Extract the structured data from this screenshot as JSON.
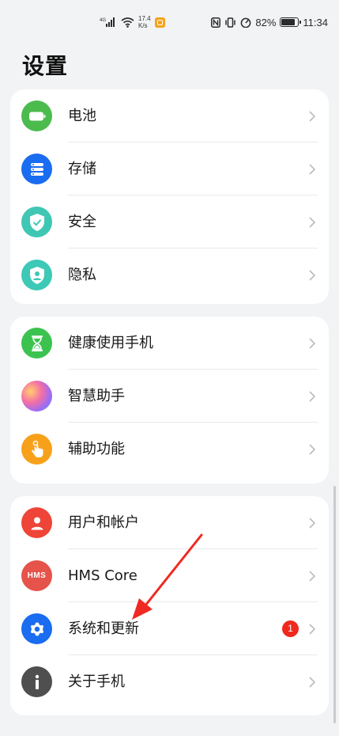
{
  "status_bar": {
    "network": "4G",
    "speed_value": "17.4",
    "speed_unit": "K/s",
    "battery_percent": "82%",
    "battery_level": 0.82,
    "time": "11:34"
  },
  "page": {
    "title": "设置"
  },
  "groups": [
    {
      "items": [
        {
          "label": "电池",
          "icon": "battery-icon",
          "color": "#4cbb4e"
        },
        {
          "label": "存储",
          "icon": "storage-icon",
          "color": "#1a6cf0"
        },
        {
          "label": "安全",
          "icon": "shield-icon",
          "color": "#3fc7b4"
        },
        {
          "label": "隐私",
          "icon": "privacy-icon",
          "color": "#3cc9b6"
        }
      ]
    },
    {
      "items": [
        {
          "label": "健康使用手机",
          "icon": "hourglass-icon",
          "color": "#3cc34f"
        },
        {
          "label": "智慧助手",
          "icon": "assistant-icon",
          "color": "#b57bf0"
        },
        {
          "label": "辅助功能",
          "icon": "hand-icon",
          "color": "#f7a11a"
        }
      ]
    },
    {
      "items": [
        {
          "label": "用户和帐户",
          "icon": "user-icon",
          "color": "#ef4438"
        },
        {
          "label": "HMS Core",
          "icon": "hms-icon",
          "icon_text": "HMS",
          "color": "#e5534b"
        },
        {
          "label": "系统和更新",
          "icon": "gear-icon",
          "color": "#1a6cf0",
          "badge": "1"
        },
        {
          "label": "关于手机",
          "icon": "info-icon",
          "color": "#4f4f4f"
        }
      ]
    }
  ]
}
